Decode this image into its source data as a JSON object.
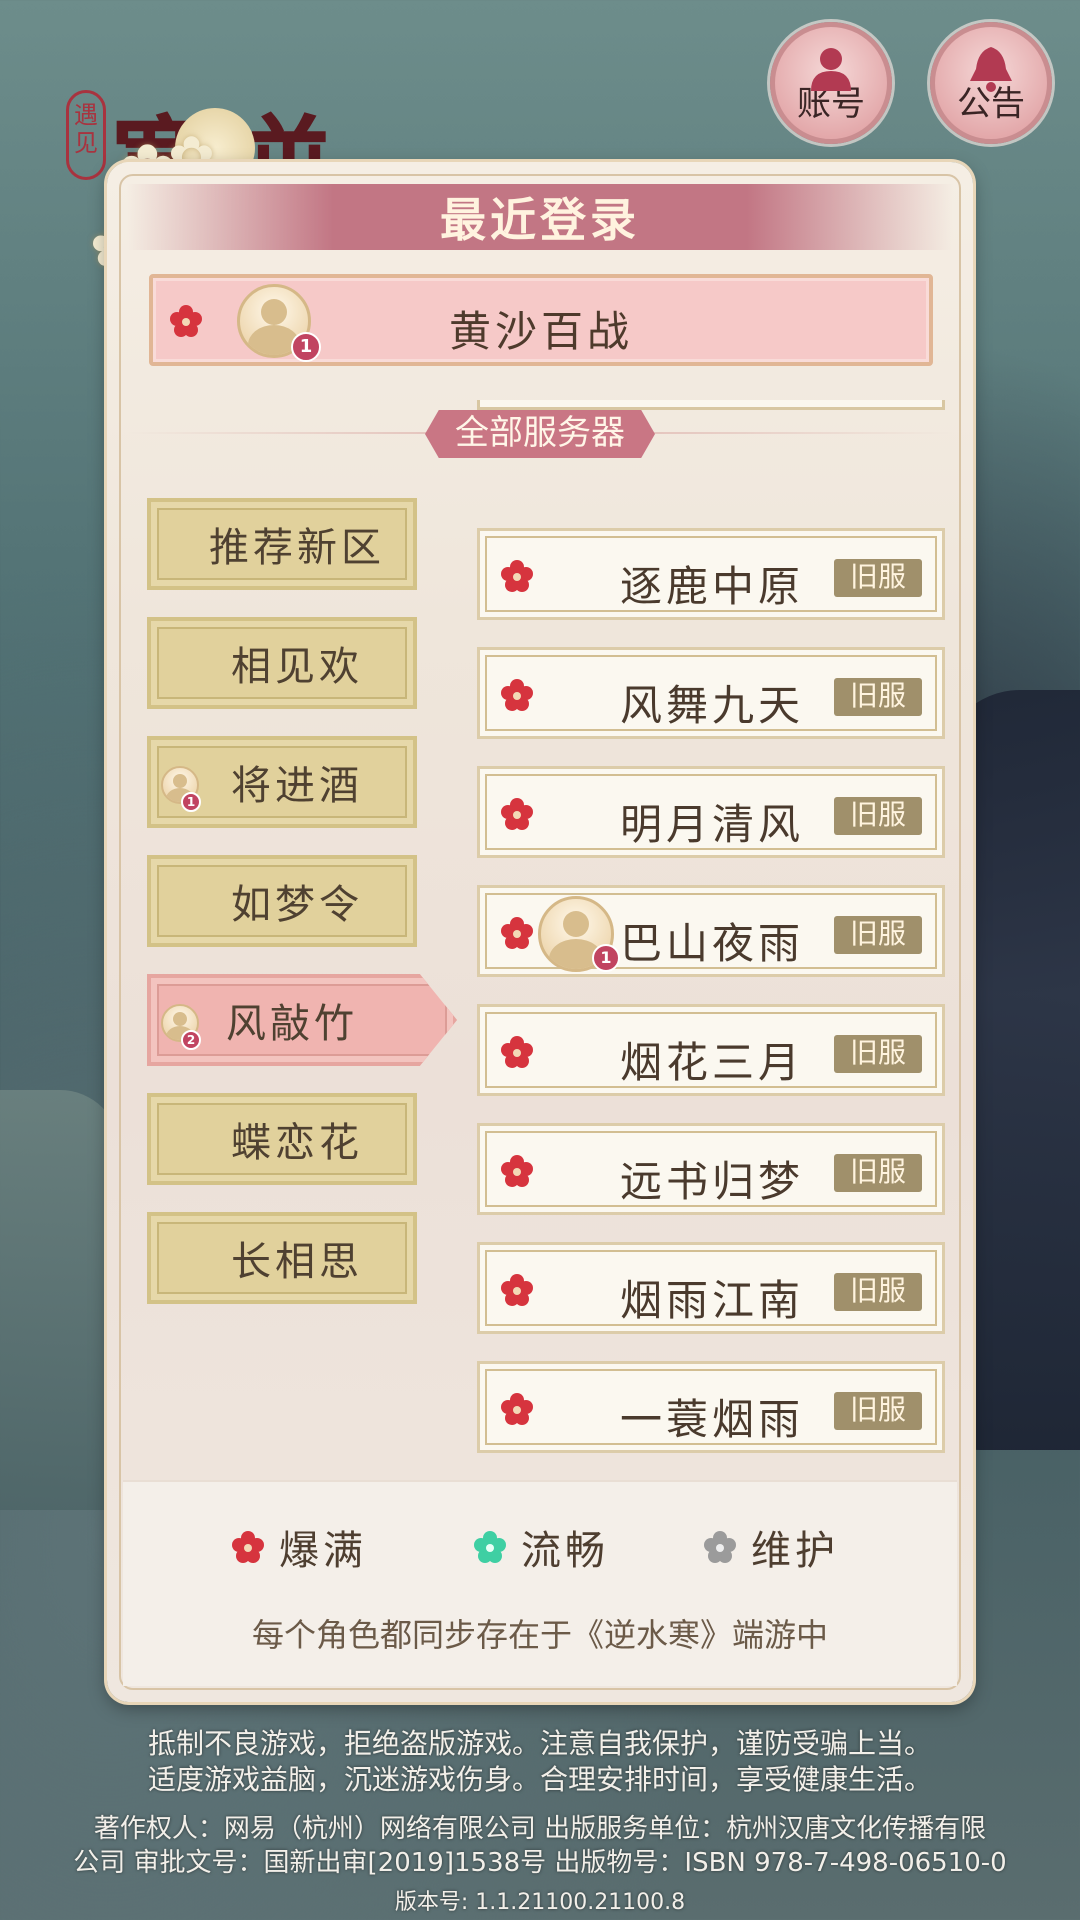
{
  "logo": {
    "seal_text": "遇见",
    "title_text": "逆水寒"
  },
  "top_buttons": [
    {
      "label": "账号",
      "icon": "person-icon"
    },
    {
      "label": "公告",
      "icon": "bell-icon"
    }
  ],
  "recent": {
    "title": "最近登录",
    "server_name": "黄沙百战",
    "role_count": "1",
    "status": "爆满"
  },
  "all_servers_label": "全部服务器",
  "categories": [
    {
      "label": "推荐新区",
      "role_count": ""
    },
    {
      "label": "相见欢",
      "role_count": ""
    },
    {
      "label": "将进酒",
      "role_count": "1"
    },
    {
      "label": "如梦令",
      "role_count": ""
    },
    {
      "label": "风敲竹",
      "role_count": "2",
      "selected": true
    },
    {
      "label": "蝶恋花",
      "role_count": ""
    },
    {
      "label": "长相思",
      "role_count": ""
    }
  ],
  "servers": [
    {
      "name": "逐鹿中原",
      "tag": "旧服",
      "status": "爆满",
      "role_count": ""
    },
    {
      "name": "风舞九天",
      "tag": "旧服",
      "status": "爆满",
      "role_count": ""
    },
    {
      "name": "明月清风",
      "tag": "旧服",
      "status": "爆满",
      "role_count": ""
    },
    {
      "name": "巴山夜雨",
      "tag": "旧服",
      "status": "爆满",
      "role_count": "1"
    },
    {
      "name": "烟花三月",
      "tag": "旧服",
      "status": "爆满",
      "role_count": ""
    },
    {
      "name": "远书归梦",
      "tag": "旧服",
      "status": "爆满",
      "role_count": ""
    },
    {
      "name": "烟雨江南",
      "tag": "旧服",
      "status": "爆满",
      "role_count": ""
    },
    {
      "name": "一蓑烟雨",
      "tag": "旧服",
      "status": "爆满",
      "role_count": ""
    }
  ],
  "legend": [
    {
      "label": "爆满",
      "color": "#d6343e"
    },
    {
      "label": "流畅",
      "color": "#3fcfa3"
    },
    {
      "label": "维护",
      "color": "#9b9b9b"
    }
  ],
  "sync_note": "每个角色都同步存在于《逆水寒》端游中",
  "footer": {
    "line1": "抵制不良游戏，拒绝盗版游戏。注意自我保护，谨防受骗上当。",
    "line2": "适度游戏益脑，沉迷游戏伤身。合理安排时间，享受健康生活。",
    "line3": "著作权人：网易（杭州）网络有限公司 出版服务单位：杭州汉唐文化传播有限",
    "line4": "公司 审批文号：国新出审[2019]1538号 出版物号：ISBN 978-7-498-06510-0",
    "version": "版本号: 1.1.21100.21100.8"
  }
}
